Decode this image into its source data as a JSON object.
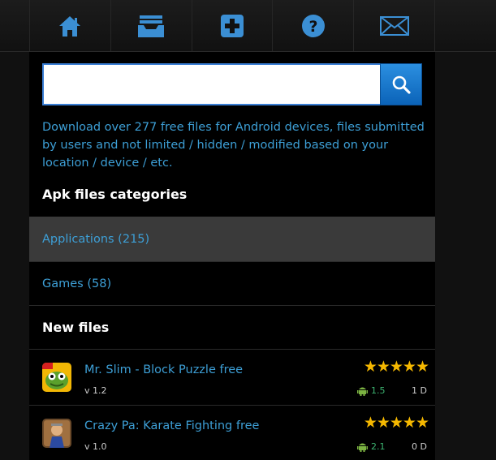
{
  "search": {
    "value": "",
    "placeholder": ""
  },
  "intro_text": "Download over 277 free files for Android devices, files submitted by users and not limited / hidden / modified based on your location / device / etc.",
  "categories_title": "Apk files categories",
  "categories": [
    {
      "label": "Applications (215)"
    },
    {
      "label": "Games (58)"
    }
  ],
  "new_files_title": "New files",
  "files": [
    {
      "name": "Mr. Slim - Block Puzzle free",
      "version": "v 1.2",
      "stars": "★★★★★",
      "rating": "1.5",
      "downloads": "1 D"
    },
    {
      "name": "Crazy Pa: Karate Fighting free",
      "version": "v 1.0",
      "stars": "★★★★★",
      "rating": "2.1",
      "downloads": "0 D"
    }
  ],
  "colors": {
    "link": "#3d9fd6",
    "accent": "#1a7fd0",
    "star": "#f5b800",
    "rating": "#3cb371"
  },
  "icons": [
    "home-icon",
    "inbox-icon",
    "plus-icon",
    "help-icon",
    "mail-icon",
    "search-icon",
    "android-icon"
  ]
}
